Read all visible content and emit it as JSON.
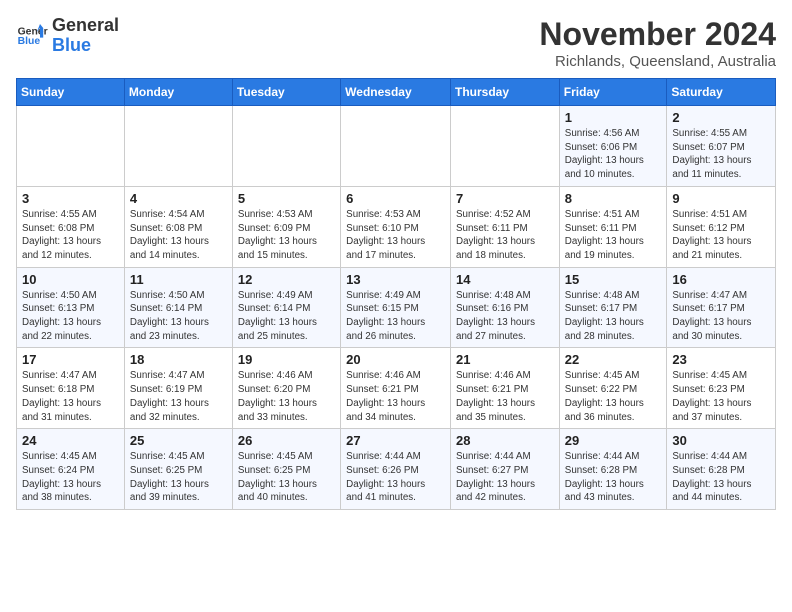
{
  "logo": {
    "line1": "General",
    "line2": "Blue"
  },
  "title": "November 2024",
  "location": "Richlands, Queensland, Australia",
  "days_header": [
    "Sunday",
    "Monday",
    "Tuesday",
    "Wednesday",
    "Thursday",
    "Friday",
    "Saturday"
  ],
  "weeks": [
    [
      {
        "day": "",
        "info": ""
      },
      {
        "day": "",
        "info": ""
      },
      {
        "day": "",
        "info": ""
      },
      {
        "day": "",
        "info": ""
      },
      {
        "day": "",
        "info": ""
      },
      {
        "day": "1",
        "info": "Sunrise: 4:56 AM\nSunset: 6:06 PM\nDaylight: 13 hours\nand 10 minutes."
      },
      {
        "day": "2",
        "info": "Sunrise: 4:55 AM\nSunset: 6:07 PM\nDaylight: 13 hours\nand 11 minutes."
      }
    ],
    [
      {
        "day": "3",
        "info": "Sunrise: 4:55 AM\nSunset: 6:08 PM\nDaylight: 13 hours\nand 12 minutes."
      },
      {
        "day": "4",
        "info": "Sunrise: 4:54 AM\nSunset: 6:08 PM\nDaylight: 13 hours\nand 14 minutes."
      },
      {
        "day": "5",
        "info": "Sunrise: 4:53 AM\nSunset: 6:09 PM\nDaylight: 13 hours\nand 15 minutes."
      },
      {
        "day": "6",
        "info": "Sunrise: 4:53 AM\nSunset: 6:10 PM\nDaylight: 13 hours\nand 17 minutes."
      },
      {
        "day": "7",
        "info": "Sunrise: 4:52 AM\nSunset: 6:11 PM\nDaylight: 13 hours\nand 18 minutes."
      },
      {
        "day": "8",
        "info": "Sunrise: 4:51 AM\nSunset: 6:11 PM\nDaylight: 13 hours\nand 19 minutes."
      },
      {
        "day": "9",
        "info": "Sunrise: 4:51 AM\nSunset: 6:12 PM\nDaylight: 13 hours\nand 21 minutes."
      }
    ],
    [
      {
        "day": "10",
        "info": "Sunrise: 4:50 AM\nSunset: 6:13 PM\nDaylight: 13 hours\nand 22 minutes."
      },
      {
        "day": "11",
        "info": "Sunrise: 4:50 AM\nSunset: 6:14 PM\nDaylight: 13 hours\nand 23 minutes."
      },
      {
        "day": "12",
        "info": "Sunrise: 4:49 AM\nSunset: 6:14 PM\nDaylight: 13 hours\nand 25 minutes."
      },
      {
        "day": "13",
        "info": "Sunrise: 4:49 AM\nSunset: 6:15 PM\nDaylight: 13 hours\nand 26 minutes."
      },
      {
        "day": "14",
        "info": "Sunrise: 4:48 AM\nSunset: 6:16 PM\nDaylight: 13 hours\nand 27 minutes."
      },
      {
        "day": "15",
        "info": "Sunrise: 4:48 AM\nSunset: 6:17 PM\nDaylight: 13 hours\nand 28 minutes."
      },
      {
        "day": "16",
        "info": "Sunrise: 4:47 AM\nSunset: 6:17 PM\nDaylight: 13 hours\nand 30 minutes."
      }
    ],
    [
      {
        "day": "17",
        "info": "Sunrise: 4:47 AM\nSunset: 6:18 PM\nDaylight: 13 hours\nand 31 minutes."
      },
      {
        "day": "18",
        "info": "Sunrise: 4:47 AM\nSunset: 6:19 PM\nDaylight: 13 hours\nand 32 minutes."
      },
      {
        "day": "19",
        "info": "Sunrise: 4:46 AM\nSunset: 6:20 PM\nDaylight: 13 hours\nand 33 minutes."
      },
      {
        "day": "20",
        "info": "Sunrise: 4:46 AM\nSunset: 6:21 PM\nDaylight: 13 hours\nand 34 minutes."
      },
      {
        "day": "21",
        "info": "Sunrise: 4:46 AM\nSunset: 6:21 PM\nDaylight: 13 hours\nand 35 minutes."
      },
      {
        "day": "22",
        "info": "Sunrise: 4:45 AM\nSunset: 6:22 PM\nDaylight: 13 hours\nand 36 minutes."
      },
      {
        "day": "23",
        "info": "Sunrise: 4:45 AM\nSunset: 6:23 PM\nDaylight: 13 hours\nand 37 minutes."
      }
    ],
    [
      {
        "day": "24",
        "info": "Sunrise: 4:45 AM\nSunset: 6:24 PM\nDaylight: 13 hours\nand 38 minutes."
      },
      {
        "day": "25",
        "info": "Sunrise: 4:45 AM\nSunset: 6:25 PM\nDaylight: 13 hours\nand 39 minutes."
      },
      {
        "day": "26",
        "info": "Sunrise: 4:45 AM\nSunset: 6:25 PM\nDaylight: 13 hours\nand 40 minutes."
      },
      {
        "day": "27",
        "info": "Sunrise: 4:44 AM\nSunset: 6:26 PM\nDaylight: 13 hours\nand 41 minutes."
      },
      {
        "day": "28",
        "info": "Sunrise: 4:44 AM\nSunset: 6:27 PM\nDaylight: 13 hours\nand 42 minutes."
      },
      {
        "day": "29",
        "info": "Sunrise: 4:44 AM\nSunset: 6:28 PM\nDaylight: 13 hours\nand 43 minutes."
      },
      {
        "day": "30",
        "info": "Sunrise: 4:44 AM\nSunset: 6:28 PM\nDaylight: 13 hours\nand 44 minutes."
      }
    ]
  ]
}
